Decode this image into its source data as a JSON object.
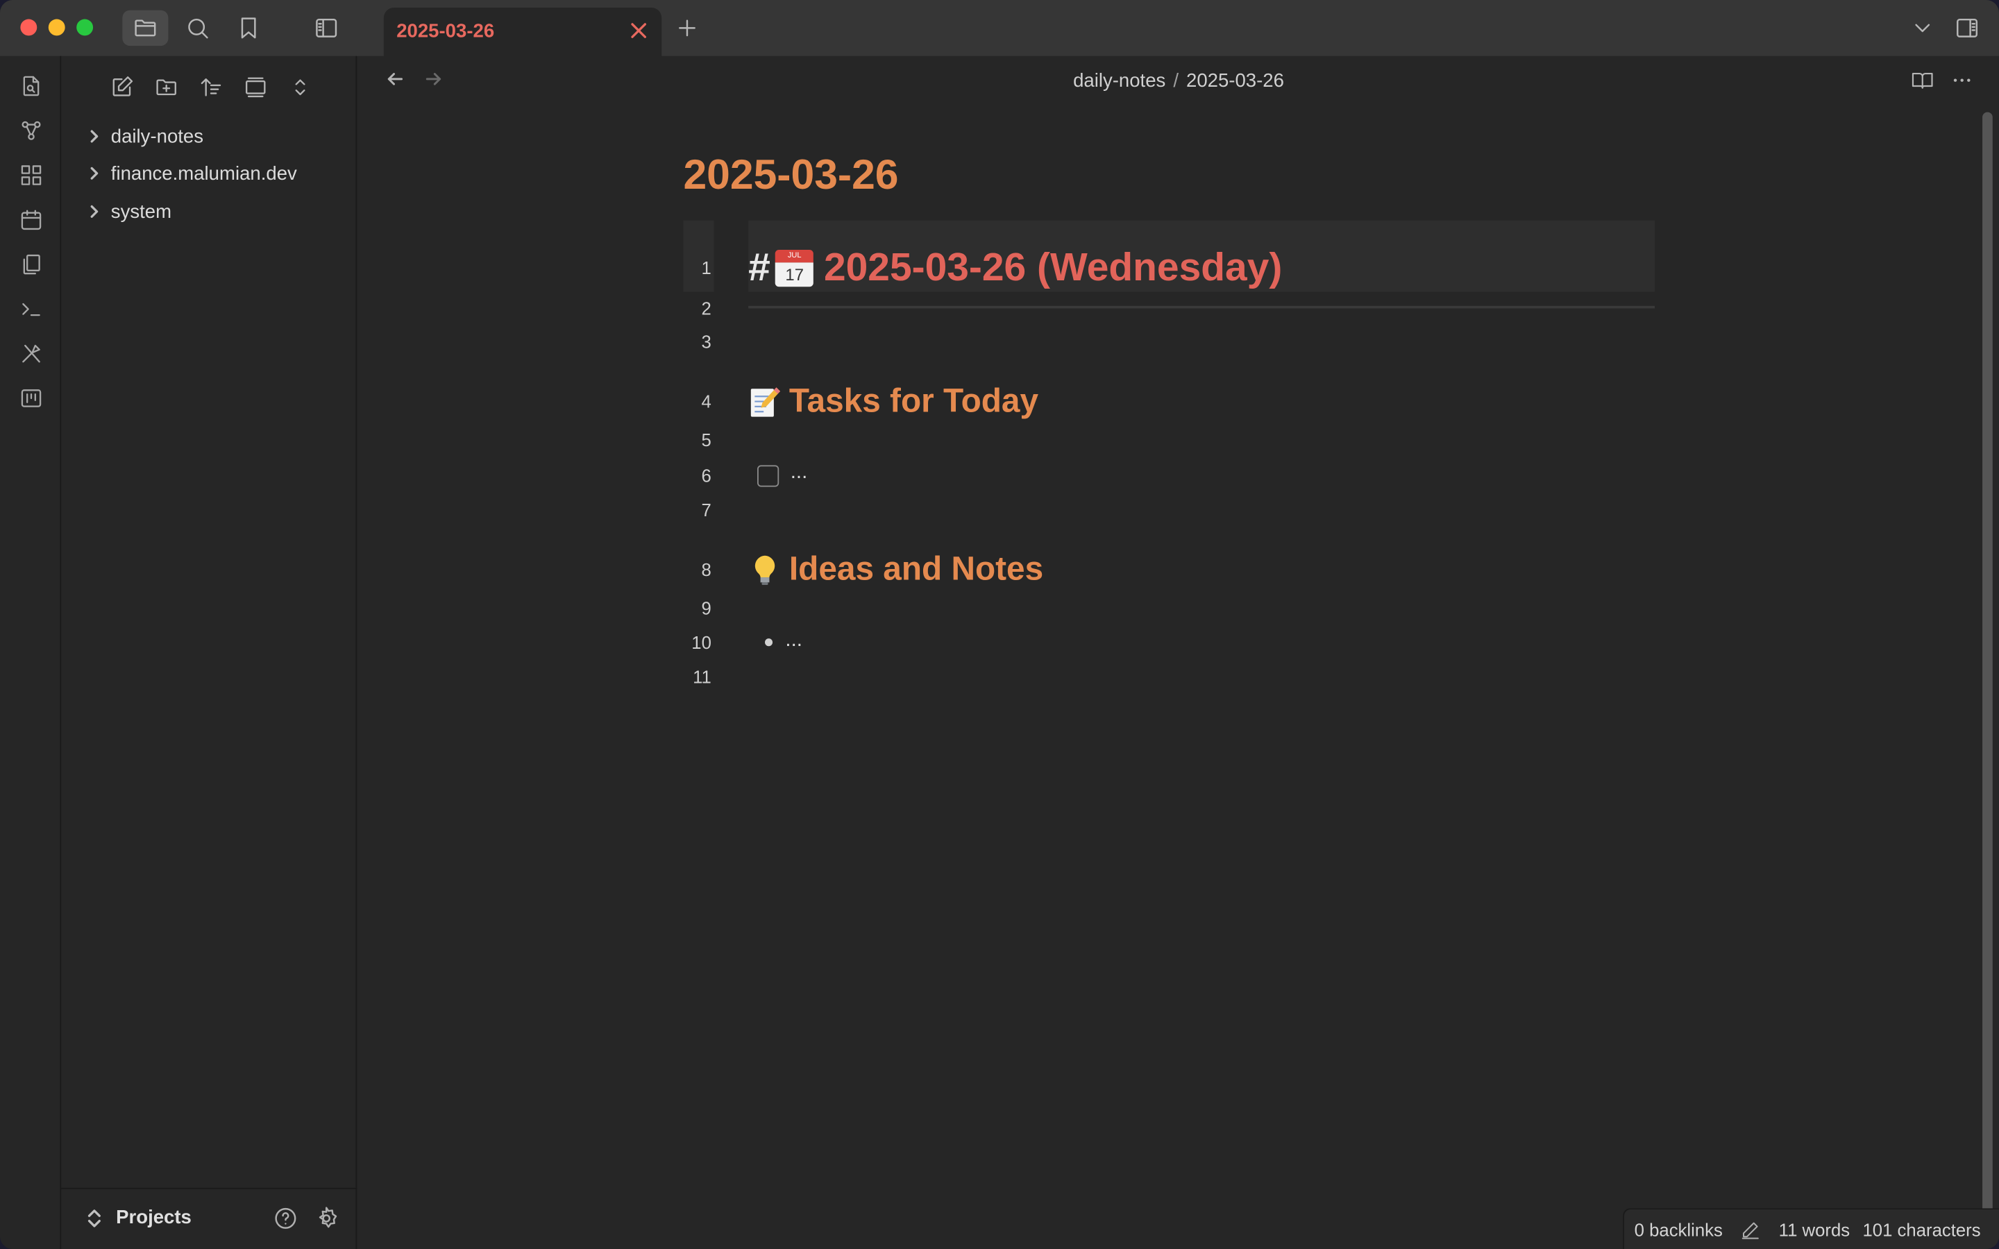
{
  "titlebar": {
    "tab_title": "2025-03-26"
  },
  "sidebar": {
    "folders": [
      {
        "label": "daily-notes"
      },
      {
        "label": "finance.malumian.dev"
      },
      {
        "label": "system"
      }
    ],
    "vault_name": "Projects"
  },
  "main": {
    "breadcrumb_folder": "daily-notes",
    "breadcrumb_sep": "/",
    "breadcrumb_file": "2025-03-26",
    "inline_title": "2025-03-26",
    "line_numbers": [
      "1",
      "2",
      "3",
      "4",
      "5",
      "6",
      "7",
      "8",
      "9",
      "10",
      "11"
    ],
    "h1_hash": "#",
    "h1_text": "2025-03-26 (Wednesday)",
    "calendar_month": "JUL",
    "calendar_day": "17",
    "h2_tasks": "Tasks for Today",
    "task_item": "...",
    "h2_ideas": "Ideas and Notes",
    "bullet_item": "..."
  },
  "statusbar": {
    "backlinks": "0 backlinks",
    "words": "11 words",
    "characters": "101 characters"
  },
  "colors": {
    "accent_tab": "#e8695f",
    "heading_orange": "#e58a4f",
    "h1_red": "#e2645a"
  },
  "icons": [
    "folder-icon",
    "search-icon",
    "bookmark-icon",
    "sidebar-toggle-icon",
    "plus-icon",
    "chevron-down-icon",
    "right-sidebar-icon",
    "open-file-icon",
    "graph-icon",
    "canvas-icon",
    "calendar-icon",
    "templates-icon",
    "terminal-icon",
    "command-palette-icon",
    "kanban-icon",
    "new-note-icon",
    "new-folder-icon",
    "sort-icon",
    "collapse-icon",
    "expand-icon",
    "help-icon",
    "settings-icon",
    "back-arrow-icon",
    "forward-arrow-icon",
    "reading-view-icon",
    "more-options-icon",
    "pencil-icon"
  ]
}
